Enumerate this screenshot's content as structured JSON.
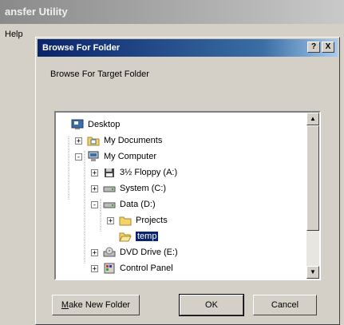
{
  "background_window": {
    "title": "ansfer Utility",
    "menu_help": "Help"
  },
  "dialog": {
    "title": "Browse For Folder",
    "help_button": "?",
    "close_button": "X",
    "label": "Browse For Target Folder",
    "tree": [
      {
        "label": "Desktop",
        "expander": "",
        "icon": "desktop-icon"
      },
      {
        "label": "My Documents",
        "expander": "+",
        "icon": "folder-docs-icon"
      },
      {
        "label": "My Computer",
        "expander": "-",
        "icon": "computer-icon"
      },
      {
        "label": "3½ Floppy (A:)",
        "expander": "+",
        "icon": "floppy-icon"
      },
      {
        "label": "System (C:)",
        "expander": "+",
        "icon": "drive-icon"
      },
      {
        "label": "Data (D:)",
        "expander": "-",
        "icon": "drive-icon"
      },
      {
        "label": "Projects",
        "expander": "+",
        "icon": "folder-icon"
      },
      {
        "label": "temp",
        "expander": "",
        "icon": "folder-open-icon",
        "selected": true
      },
      {
        "label": "DVD Drive (E:)",
        "expander": "+",
        "icon": "dvd-icon"
      },
      {
        "label": "Control Panel",
        "expander": "+",
        "icon": "control-panel-icon"
      }
    ],
    "buttons": {
      "new_folder_prefix": "M",
      "new_folder_rest": "ake New Folder",
      "ok": "OK",
      "cancel": "Cancel"
    },
    "colors": {
      "title_bar": "#0a246a",
      "selection": "#0a246a",
      "face": "#d4d0c8"
    }
  }
}
